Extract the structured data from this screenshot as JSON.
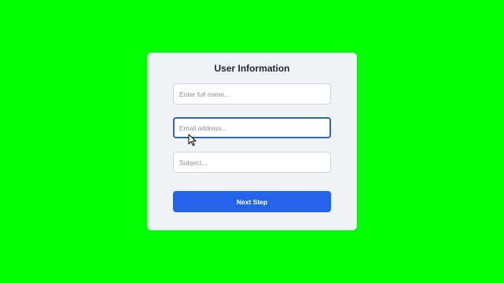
{
  "form": {
    "title": "User Information",
    "fields": [
      {
        "name": "full-name",
        "value": "",
        "placeholder": "Enter full name..."
      },
      {
        "name": "email",
        "value": "",
        "placeholder": "Email address..."
      },
      {
        "name": "subject",
        "value": "",
        "placeholder": "Subject..."
      }
    ],
    "submit_label": "Next Step"
  },
  "colors": {
    "background": "#00ff00",
    "card": "#f1f2f6",
    "accent": "#2563eb",
    "focus_border": "#2d66b8"
  },
  "icons": {
    "cursor": "mouse-pointer-icon"
  }
}
